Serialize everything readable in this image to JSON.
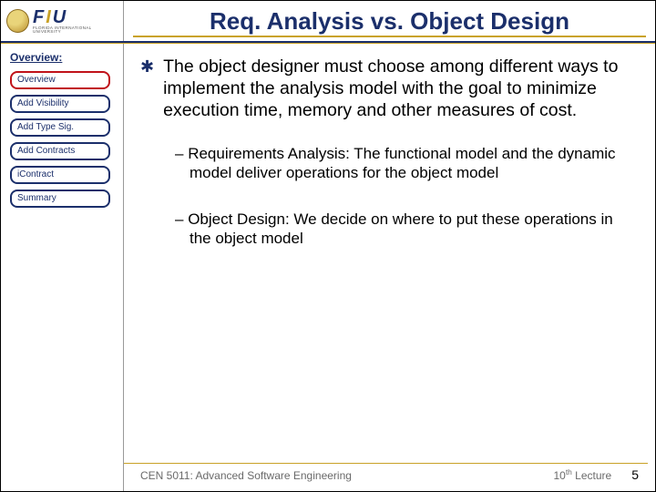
{
  "header": {
    "logo_letters": {
      "f": "F",
      "i": "I",
      "u": "U"
    },
    "logo_sub": "FLORIDA INTERNATIONAL UNIVERSITY",
    "title": "Req. Analysis vs. Object Design"
  },
  "sidebar": {
    "heading": "Overview:",
    "items": [
      {
        "label": "Overview",
        "active": true
      },
      {
        "label": "Add Visibility",
        "active": false
      },
      {
        "label": "Add Type Sig.",
        "active": false
      },
      {
        "label": "Add Contracts",
        "active": false
      },
      {
        "label": "iContract",
        "active": false
      },
      {
        "label": "Summary",
        "active": false
      }
    ]
  },
  "content": {
    "main_bullet": "The object designer must choose among different ways to implement the analysis model with the goal to minimize execution time, memory and other measures of cost.",
    "sub_bullets": [
      "Requirements Analysis: The functional model and the dynamic model deliver operations for the object model",
      "Object Design: We decide on  where to put these operations in the object model"
    ]
  },
  "footer": {
    "left": "CEN 5011: Advanced Software Engineering",
    "right_pre": "10",
    "right_sup": "th",
    "right_post": " Lecture",
    "page": "5"
  }
}
